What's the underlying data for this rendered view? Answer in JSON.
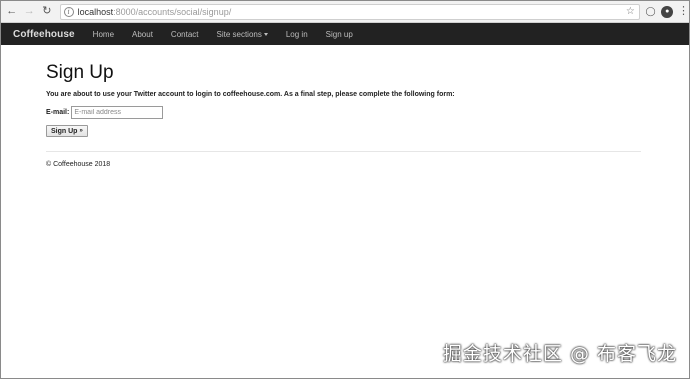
{
  "browser": {
    "url_host": "localhost",
    "url_rest": ":8000/accounts/social/signup/"
  },
  "navbar": {
    "brand": "Coffeehouse",
    "links": [
      "Home",
      "About",
      "Contact",
      "Site sections",
      "Log in",
      "Sign up"
    ]
  },
  "page": {
    "title": "Sign Up",
    "intro": "You are about to use your Twitter account to login to coffeehouse.com. As a final step, please complete the following form:",
    "email_label": "E-mail:",
    "email_placeholder": "E-mail address",
    "email_value": "",
    "submit_label": "Sign Up",
    "submit_arrow": "»"
  },
  "footer": {
    "text": "© Coffeehouse 2018"
  },
  "watermark": "掘金技术社区 @ 布客飞龙"
}
